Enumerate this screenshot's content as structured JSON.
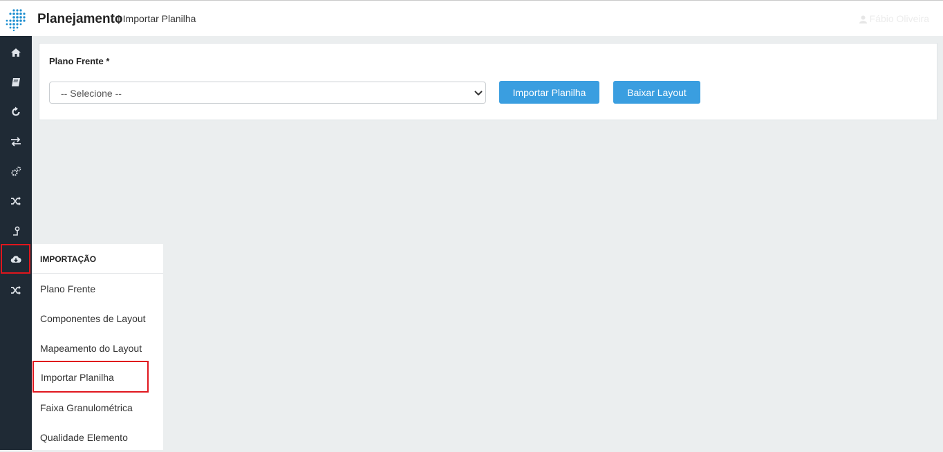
{
  "header": {
    "app_title": "Planejamento",
    "separator": "|",
    "page_title": "Importar Planilha",
    "user_name": "Fábio Oliveira"
  },
  "sidebar": {
    "items": [
      {
        "icon": "home-icon"
      },
      {
        "icon": "book-icon"
      },
      {
        "icon": "refresh-icon"
      },
      {
        "icon": "exchange-icon"
      },
      {
        "icon": "gears-icon"
      },
      {
        "icon": "shuffle-icon"
      },
      {
        "icon": "key-icon"
      },
      {
        "icon": "cloud-download-icon",
        "active": true
      },
      {
        "icon": "shuffle-icon"
      }
    ]
  },
  "form": {
    "label": "Plano Frente *",
    "select_value": "-- Selecione --",
    "import_button": "Importar Planilha",
    "download_button": "Baixar Layout"
  },
  "flyout": {
    "header": "IMPORTAÇÃO",
    "items": [
      {
        "label": "Plano Frente"
      },
      {
        "label": "Componentes de Layout"
      },
      {
        "label": "Mapeamento do Layout"
      },
      {
        "label": "Importar Planilha",
        "active": true
      },
      {
        "label": "Faixa Granulométrica"
      },
      {
        "label": "Qualidade Elemento"
      }
    ]
  },
  "colors": {
    "sidebar_bg": "#1f2a35",
    "button_bg": "#3a9ee0",
    "highlight": "#e0161d",
    "content_bg": "#ebeeef"
  }
}
